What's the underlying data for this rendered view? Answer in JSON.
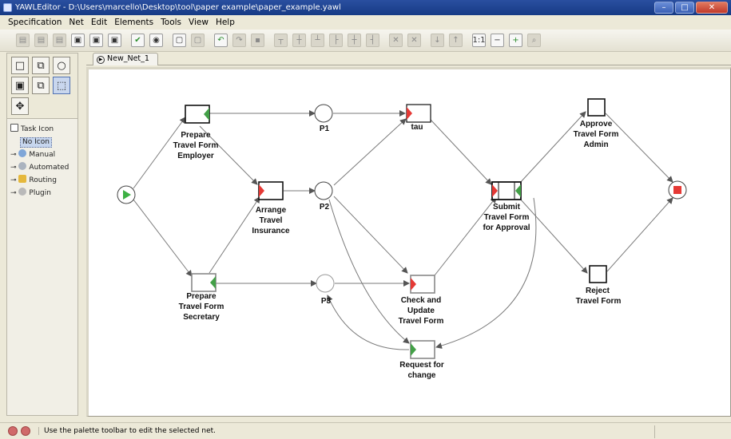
{
  "window": {
    "title": "YAWLEditor - D:\\Users\\marcello\\Desktop\\tool\\paper example\\paper_example.yawl",
    "buttons": [
      "–",
      "□",
      "✕"
    ]
  },
  "menu": [
    "Specification",
    "Net",
    "Edit",
    "Elements",
    "Tools",
    "View",
    "Help"
  ],
  "tree": {
    "root": "Task Icon",
    "selected": "No Icon",
    "items": [
      "Manual",
      "Automated",
      "Routing",
      "Plugin"
    ]
  },
  "tab": {
    "label": "New_Net_1"
  },
  "net": {
    "conditions": [
      "P1",
      "P2",
      "P3"
    ],
    "tasks": {
      "prepare_employer": [
        "Prepare",
        "Travel Form",
        "Employer"
      ],
      "arrange_insurance": [
        "Arrange",
        "Travel",
        "Insurance"
      ],
      "prepare_secretary": [
        "Prepare",
        "Travel Form",
        "Secretary"
      ],
      "tau": [
        "tau"
      ],
      "check_update": [
        "Check and",
        "Update",
        "Travel Form"
      ],
      "request_change": [
        "Request for",
        "change"
      ],
      "submit": [
        "Submit",
        "Travel Form",
        "for Approval"
      ],
      "approve": [
        "Approve",
        "Travel Form",
        "Admin"
      ],
      "reject": [
        "Reject",
        "Travel Form"
      ]
    }
  },
  "status": {
    "text": "Use the palette toolbar to edit the selected net."
  },
  "colors": {
    "join_red": "#e53935",
    "split_green": "#43a047",
    "input_green": "#3cb043",
    "output_red": "#e53935"
  }
}
